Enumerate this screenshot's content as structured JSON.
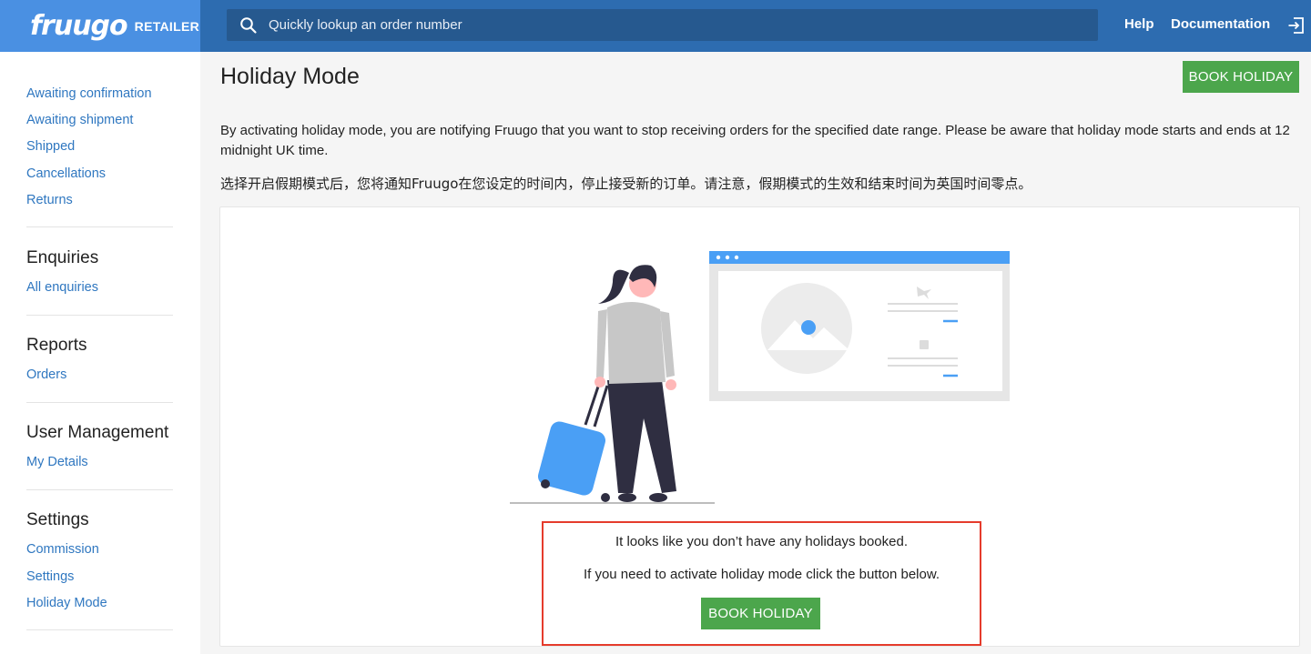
{
  "brand": {
    "logo": "fruugo",
    "sub": "RETAILER"
  },
  "search": {
    "placeholder": "Quickly lookup an order number"
  },
  "nav": {
    "help": "Help",
    "documentation": "Documentation"
  },
  "sidebar": {
    "orders_links": [
      "Awaiting confirmation",
      "Awaiting shipment",
      "Shipped",
      "Cancellations",
      "Returns"
    ],
    "sections": [
      {
        "heading": "Enquiries",
        "links": [
          "All enquiries"
        ]
      },
      {
        "heading": "Reports",
        "links": [
          "Orders"
        ]
      },
      {
        "heading": "User Management",
        "links": [
          "My Details"
        ]
      },
      {
        "heading": "Settings",
        "links": [
          "Commission",
          "Settings",
          "Holiday Mode"
        ]
      }
    ]
  },
  "main": {
    "title": "Holiday Mode",
    "book_button": "BOOK HOLIDAY",
    "description": "By activating holiday mode, you are notifying Fruugo that you want to stop receiving orders for the specified date range. Please be aware that holiday mode starts and ends at 12 midnight UK time.",
    "description_cn": "选择开启假期模式后，您将通知Fruugo在您设定的时间内，停止接受新的订单。请注意，假期模式的生效和结束时间为英国时间零点。",
    "empty_message": "It looks like you don’t have any holidays booked.",
    "empty_instruction": "If you need to activate holiday mode click the button below.",
    "empty_button": "BOOK HOLIDAY"
  },
  "colors": {
    "brand_blue": "#4a90e2",
    "header_dark": "#2d6cb0",
    "link_blue": "#2f77c0",
    "button_green": "#4ca64c",
    "highlight_red": "#e53b2c"
  }
}
